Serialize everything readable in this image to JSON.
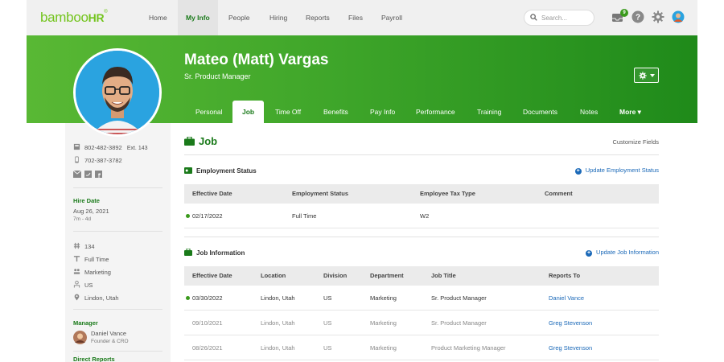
{
  "nav": {
    "logo_main": "bamboo",
    "logo_hr": "HR",
    "logo_reg": "®",
    "items": [
      "Home",
      "My Info",
      "People",
      "Hiring",
      "Reports",
      "Files",
      "Payroll"
    ],
    "active": "My Info",
    "search_placeholder": "Search...",
    "notification_count": "9",
    "icons": [
      "inbox-icon",
      "help-icon",
      "gear-icon",
      "user-avatar"
    ]
  },
  "employee": {
    "name": "Mateo (Matt) Vargas",
    "title": "Sr. Product Manager"
  },
  "tabs": [
    "Personal",
    "Job",
    "Time Off",
    "Benefits",
    "Pay Info",
    "Performance",
    "Training",
    "Documents",
    "Notes",
    "More ▾"
  ],
  "active_tab": "Job",
  "sidebar": {
    "work_phone": "802-482-3892",
    "ext": "Ext. 143",
    "mobile_phone": "702-387-3782",
    "hire_date_label": "Hire Date",
    "hire_date": "Aug 26, 2021",
    "tenure": "7m - 4d",
    "employee_number": "134",
    "employment_type": "Full Time",
    "department": "Marketing",
    "country": "US",
    "location": "Lindon, Utah",
    "manager_label": "Manager",
    "manager_name": "Daniel Vance",
    "manager_title": "Founder & CRO",
    "direct_reports_label": "Direct Reports"
  },
  "job": {
    "title": "Job",
    "customize": "Customize Fields",
    "employment_status": {
      "title": "Employment Status",
      "action": "Update Employment Status",
      "columns": [
        "Effective Date",
        "Employment Status",
        "Employee Tax Type",
        "Comment"
      ],
      "rows": [
        [
          "02/17/2022",
          "Full Time",
          "W2",
          ""
        ]
      ]
    },
    "job_information": {
      "title": "Job Information",
      "action": "Update Job Information",
      "columns": [
        "Effective Date",
        "Location",
        "Division",
        "Department",
        "Job Title",
        "Reports To"
      ],
      "rows": [
        [
          "03/30/2022",
          "Lindon, Utah",
          "US",
          "Marketing",
          "Sr. Product Manager",
          "Daniel Vance"
        ],
        [
          "09/10/2021",
          "Lindon, Utah",
          "US",
          "Marketing",
          "Sr. Product Manager",
          "Greg Stevenson"
        ],
        [
          "08/26/2021",
          "Lindon, Utah",
          "US",
          "Marketing",
          "Product Marketing Manager",
          "Greg Stevenson"
        ]
      ]
    }
  },
  "colors": {
    "brand_green": "#73c41d",
    "header_green": "#3fa62a",
    "link_blue": "#1b69b8"
  }
}
